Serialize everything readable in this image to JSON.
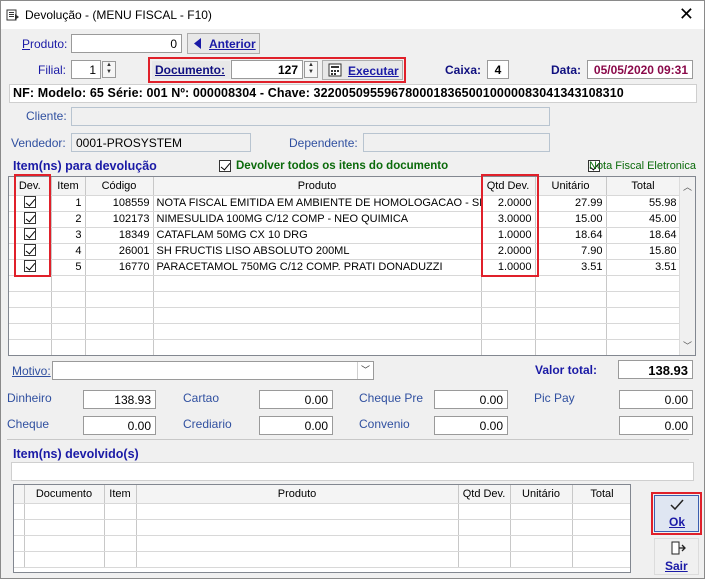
{
  "window": {
    "title": "Devolução - (MENU FISCAL - F10)",
    "close": "✕"
  },
  "produto": {
    "label": "Produto:",
    "value": "0",
    "anterior": "Anterior"
  },
  "filial": {
    "label": "Filial:",
    "value": "1"
  },
  "documento": {
    "label": "Documento:",
    "value": "127",
    "executar": "Executar"
  },
  "caixa": {
    "label": "Caixa:",
    "value": "4"
  },
  "data": {
    "label": "Data:",
    "value": "05/05/2020 09:31"
  },
  "nf_line": "NF: Modelo: 65 Série: 001 Nº: 000008304 - Chave: 32200509559678000183650010000083041343108310",
  "cliente": {
    "label": "Cliente:",
    "value": ""
  },
  "vendedor": {
    "label": "Vendedor:",
    "value": "0001-PROSYSTEM"
  },
  "dependente": {
    "label": "Dependente:",
    "value": ""
  },
  "items_section": {
    "title": "Item(ns) para devolução",
    "devolver_todos": "Devolver todos os itens do documento",
    "nota_fiscal": "Nota Fiscal Eletronica"
  },
  "items_table": {
    "headers": [
      "Dev.",
      "Item",
      "Código",
      "Produto",
      "Qtd Dev.",
      "Unitário",
      "Total"
    ],
    "rows": [
      {
        "item": "1",
        "codigo": "108559",
        "produto": "NOTA FISCAL EMITIDA EM AMBIENTE DE HOMOLOGACAO - SEM V",
        "qtd": "2.0000",
        "unitario": "27.99",
        "total": "55.98"
      },
      {
        "item": "2",
        "codigo": "102173",
        "produto": "NIMESULIDA 100MG C/12 COMP - NEO QUIMICA",
        "qtd": "3.0000",
        "unitario": "15.00",
        "total": "45.00"
      },
      {
        "item": "3",
        "codigo": "18349",
        "produto": "CATAFLAM 50MG CX 10 DRG",
        "qtd": "1.0000",
        "unitario": "18.64",
        "total": "18.64"
      },
      {
        "item": "4",
        "codigo": "26001",
        "produto": "SH FRUCTIS LISO ABSOLUTO 200ML",
        "qtd": "2.0000",
        "unitario": "7.90",
        "total": "15.80"
      },
      {
        "item": "5",
        "codigo": "16770",
        "produto": "PARACETAMOL 750MG C/12 COMP. PRATI DONADUZZI",
        "qtd": "1.0000",
        "unitario": "3.51",
        "total": "3.51"
      }
    ]
  },
  "motivo": {
    "label": "Motivo:",
    "value": ""
  },
  "valor_total": {
    "label": "Valor total:",
    "value": "138.93"
  },
  "payments": [
    {
      "label": "Dinheiro",
      "value": "138.93"
    },
    {
      "label": "Cartao",
      "value": "0.00"
    },
    {
      "label": "Cheque Pre",
      "value": "0.00"
    },
    {
      "label": "Pic Pay",
      "value": "0.00"
    },
    {
      "label": "Cheque",
      "value": "0.00"
    },
    {
      "label": "Crediario",
      "value": "0.00"
    },
    {
      "label": "Convenio",
      "value": "0.00"
    },
    {
      "label": "",
      "value": "0.00"
    }
  ],
  "devolvidos_section": {
    "title": "Item(ns) devolvido(s)"
  },
  "devolvidos_table": {
    "headers": [
      "Documento",
      "Item",
      "Produto",
      "Qtd Dev.",
      "Unitário",
      "Total"
    ]
  },
  "buttons": {
    "ok": "Ok",
    "sair": "Sair"
  }
}
